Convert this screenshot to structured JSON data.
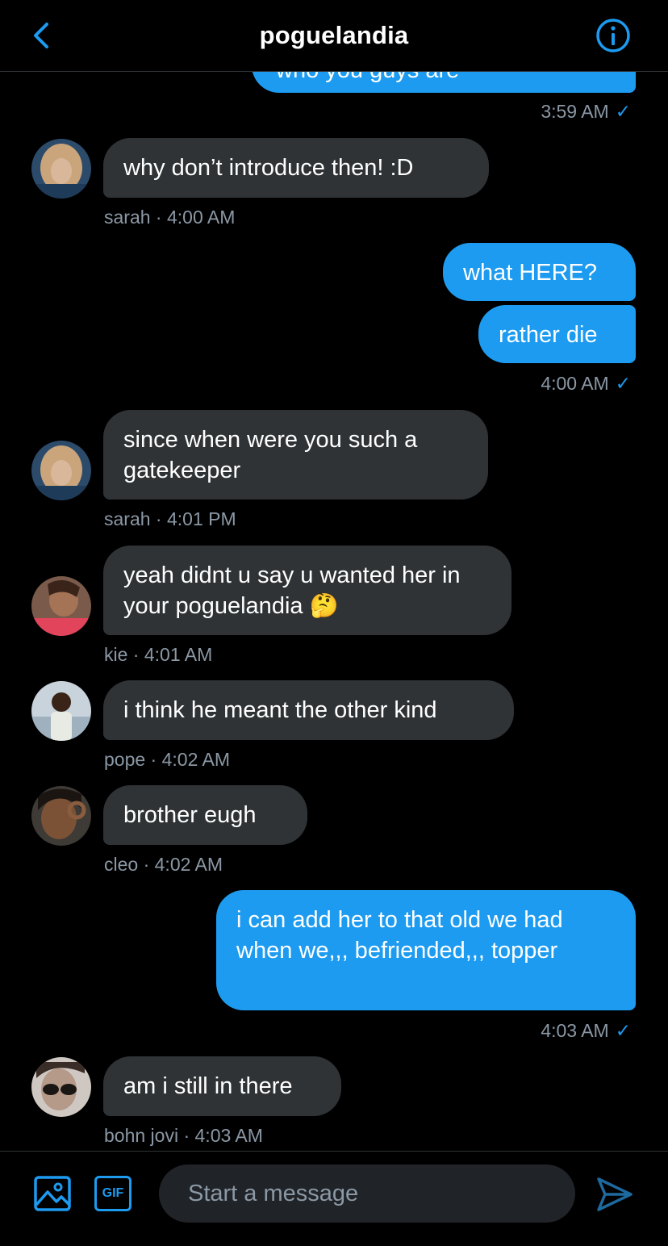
{
  "header": {
    "title": "poguelandia"
  },
  "messages": [
    {
      "text": "why don’t introduce then! :D",
      "meta": "sarah · 4:00 AM"
    },
    {
      "text": "what HERE?"
    },
    {
      "text": "rather die",
      "meta": "4:00 AM"
    },
    {
      "text": "since when were you such a gatekeeper",
      "meta": "sarah · 4:01 PM"
    },
    {
      "text": "yeah didnt u say u wanted her in your poguelandia 🤔",
      "meta": "kie · 4:01 AM"
    },
    {
      "text": "i think he meant the other kind",
      "meta": "pope · 4:02 AM"
    },
    {
      "text": "brother eugh",
      "meta": "cleo · 4:02 AM"
    },
    {
      "text": "i can add her to that old we had when we,,, befriended,,, topper",
      "meta": "4:03 AM"
    },
    {
      "text": "am i still in there",
      "meta": "bohn jovi · 4:03 AM"
    }
  ],
  "top_partial": {
    "text": "who you guys are",
    "meta": "3:59 AM"
  },
  "composer": {
    "placeholder": "Start a message",
    "gif_label": "GIF"
  },
  "colors": {
    "accent": "#1d9bf0",
    "bubble_in": "#2f3336",
    "muted": "#8b98a5"
  }
}
